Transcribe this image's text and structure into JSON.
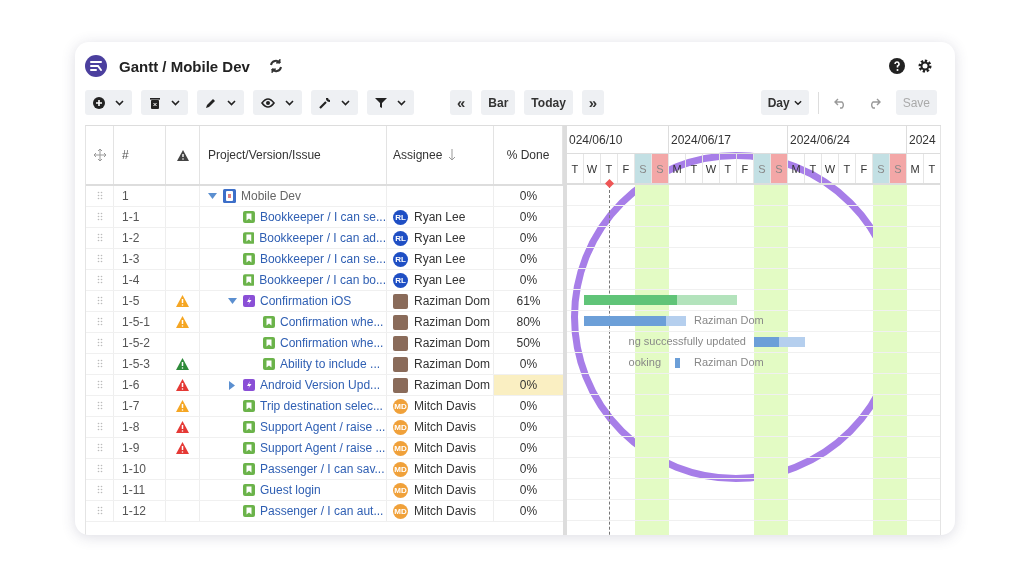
{
  "header": {
    "title": "Gantt / Mobile Dev"
  },
  "toolbar": {
    "menus": [
      {
        "kind": "add"
      },
      {
        "kind": "delete"
      },
      {
        "kind": "edit"
      },
      {
        "kind": "view"
      },
      {
        "kind": "tools"
      },
      {
        "kind": "filter"
      }
    ],
    "nav": [
      {
        "label": "«",
        "kind": "prev"
      },
      {
        "label": "Bar",
        "kind": "text"
      },
      {
        "label": "Today",
        "kind": "text"
      },
      {
        "label": "»",
        "kind": "next"
      }
    ],
    "scale": "Day",
    "save": {
      "label": "Save",
      "disabled": true
    }
  },
  "columns": {
    "number": "#",
    "issue": "Project/Version/Issue",
    "assignee": "Assignee",
    "done": "% Done"
  },
  "timeline": {
    "weeks": [
      {
        "label": "024/06/10"
      },
      {
        "label": "2024/06/17"
      },
      {
        "label": "2024/06/24"
      },
      {
        "label": "2024"
      }
    ],
    "days": [
      {
        "letter": "T",
        "kind": "weekday"
      },
      {
        "letter": "W",
        "kind": "weekday"
      },
      {
        "letter": "T",
        "kind": "weekday"
      },
      {
        "letter": "F",
        "kind": "weekday"
      },
      {
        "letter": "S",
        "kind": "saturday"
      },
      {
        "letter": "S",
        "kind": "sunday"
      },
      {
        "letter": "M",
        "kind": "weekday"
      },
      {
        "letter": "T",
        "kind": "weekday"
      },
      {
        "letter": "W",
        "kind": "weekday"
      },
      {
        "letter": "T",
        "kind": "weekday"
      },
      {
        "letter": "F",
        "kind": "weekday"
      },
      {
        "letter": "S",
        "kind": "saturday"
      },
      {
        "letter": "S",
        "kind": "sunday"
      },
      {
        "letter": "M",
        "kind": "weekday"
      },
      {
        "letter": "T",
        "kind": "weekday"
      },
      {
        "letter": "W",
        "kind": "weekday"
      },
      {
        "letter": "T",
        "kind": "weekday"
      },
      {
        "letter": "F",
        "kind": "weekday"
      },
      {
        "letter": "S",
        "kind": "saturday"
      },
      {
        "letter": "S",
        "kind": "sunday"
      },
      {
        "letter": "M",
        "kind": "weekday"
      },
      {
        "letter": "T",
        "kind": "weekday"
      }
    ]
  },
  "rows": [
    {
      "number": "1",
      "kind": "project",
      "title": "Mobile Dev",
      "expanded": true,
      "done": "0%",
      "highlighted": false,
      "children": [
        {
          "number": "1-1",
          "kind": "story",
          "title": "Bookkeeper / I can se...",
          "assignee": {
            "kind": "initials",
            "initials": "RL",
            "name": "Ryan Lee",
            "color": "#1f4fc4"
          },
          "done": "0%",
          "highlighted": false
        },
        {
          "number": "1-2",
          "kind": "story",
          "title": "Bookkeeper / I can ad...",
          "assignee": {
            "kind": "initials",
            "initials": "RL",
            "name": "Ryan Lee",
            "color": "#1f4fc4"
          },
          "done": "0%",
          "highlighted": false
        },
        {
          "number": "1-3",
          "kind": "story",
          "title": "Bookkeeper / I can se...",
          "assignee": {
            "kind": "initials",
            "initials": "RL",
            "name": "Ryan Lee",
            "color": "#1f4fc4"
          },
          "done": "0%",
          "highlighted": false
        },
        {
          "number": "1-4",
          "kind": "story",
          "title": "Bookkeeper / I can bo...",
          "assignee": {
            "kind": "initials",
            "initials": "RL",
            "name": "Ryan Lee",
            "color": "#1f4fc4"
          },
          "done": "0%",
          "highlighted": false
        },
        {
          "number": "1-5",
          "kind": "epic",
          "alert": {
            "color": "#f5a623"
          },
          "title": "Confirmation iOS",
          "expanded": true,
          "assignee": {
            "kind": "photo",
            "name": "Raziman Dom"
          },
          "done": "61%",
          "highlighted": false,
          "bar": {
            "kind": "summary",
            "level": 0.61
          },
          "children": [
            {
              "number": "1-5-1",
              "kind": "story",
              "alert": {
                "color": "#f5a623"
              },
              "title": "Confirmation whe...",
              "assignee": {
                "kind": "photo",
                "name": "Raziman Dom"
              },
              "done": "80%",
              "highlighted": false,
              "bar": {
                "kind": "task",
                "level": 0.8,
                "right_label": "Raziman Dom"
              }
            },
            {
              "number": "1-5-2",
              "kind": "story",
              "title": "Confirmation whe...",
              "assignee": {
                "kind": "photo",
                "name": "Raziman Dom"
              },
              "done": "50%",
              "highlighted": false,
              "bar": {
                "kind": "task",
                "level": 0.5,
                "left_label": "ng successfully updated"
              }
            },
            {
              "number": "1-5-3",
              "kind": "story",
              "alert": {
                "color": "#2e8b3a"
              },
              "title": "Ability to include ...",
              "assignee": {
                "kind": "photo",
                "name": "Raziman Dom"
              },
              "done": "0%",
              "highlighted": false,
              "bar": {
                "kind": "milestone-task",
                "left_label": "ooking",
                "right_label": "Raziman Dom"
              }
            }
          ]
        },
        {
          "number": "1-6",
          "kind": "epic",
          "alert": {
            "color": "#e53935"
          },
          "title": "Android Version Upd...",
          "expanded": false,
          "assignee": {
            "kind": "photo",
            "name": "Raziman Dom"
          },
          "done": "0%",
          "highlighted": true
        },
        {
          "number": "1-7",
          "kind": "story",
          "alert": {
            "color": "#f5a623"
          },
          "title": "Trip destination selec...",
          "assignee": {
            "kind": "initials",
            "initials": "MD",
            "name": "Mitch Davis",
            "color": "#f0a13a"
          },
          "done": "0%",
          "highlighted": false
        },
        {
          "number": "1-8",
          "kind": "story",
          "alert": {
            "color": "#e53935"
          },
          "title": "Support Agent / raise ...",
          "assignee": {
            "kind": "initials",
            "initials": "MD",
            "name": "Mitch Davis",
            "color": "#f0a13a"
          },
          "done": "0%",
          "highlighted": false
        },
        {
          "number": "1-9",
          "kind": "story",
          "alert": {
            "color": "#e53935"
          },
          "title": "Support Agent / raise ...",
          "assignee": {
            "kind": "initials",
            "initials": "MD",
            "name": "Mitch Davis",
            "color": "#f0a13a"
          },
          "done": "0%",
          "highlighted": false
        },
        {
          "number": "1-10",
          "kind": "story",
          "title": "Passenger / I can sav...",
          "assignee": {
            "kind": "initials",
            "initials": "MD",
            "name": "Mitch Davis",
            "color": "#f0a13a"
          },
          "done": "0%",
          "highlighted": false
        },
        {
          "number": "1-11",
          "kind": "story",
          "title": "Guest login",
          "assignee": {
            "kind": "initials",
            "initials": "MD",
            "name": "Mitch Davis",
            "color": "#f0a13a"
          },
          "done": "0%",
          "highlighted": false
        },
        {
          "number": "1-12",
          "kind": "story",
          "title": "Passenger / I can aut...",
          "assignee": {
            "kind": "initials",
            "initials": "MD",
            "name": "Mitch Davis",
            "color": "#f0a13a"
          },
          "done": "0%",
          "highlighted": false
        }
      ]
    }
  ]
}
